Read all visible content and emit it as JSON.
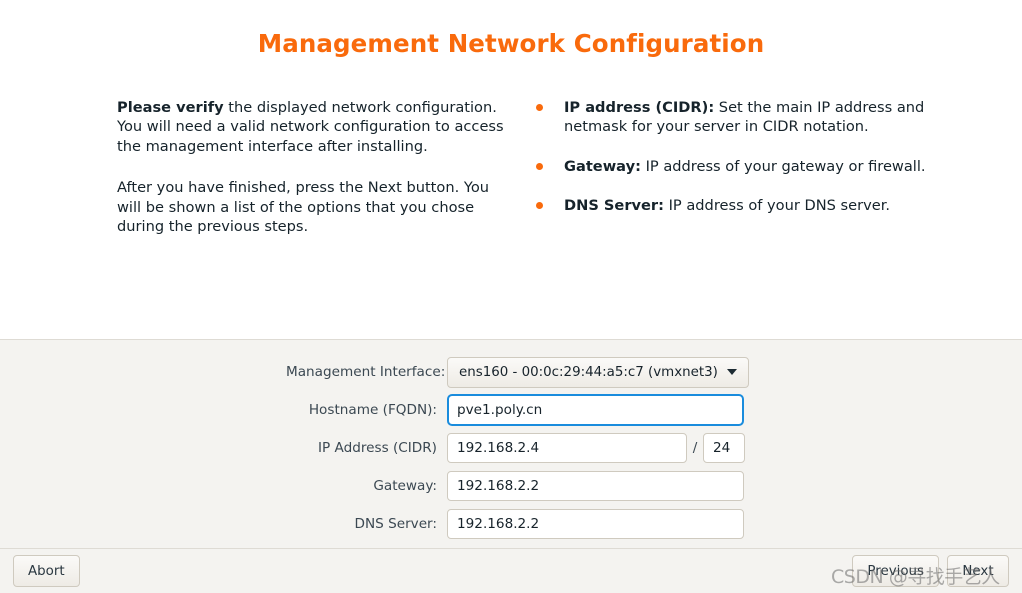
{
  "window": {
    "title": "Management Network Configuration",
    "title_color": "#f96a0c"
  },
  "info": {
    "left_paragraphs": [
      "the displayed network configuration. You will need a valid network configuration to access the management interface after installing.",
      "After you have finished, press the Next button. You will be shown a list of the options that you chose during the previous steps."
    ],
    "left_lead_bold": "Please verify",
    "bullets": [
      {
        "term": "IP address (CIDR):",
        "description": " Set the main IP address and netmask for your server in CIDR notation.",
        "bullet_color": "#f96a0c"
      },
      {
        "term": "Gateway:",
        "description": " IP address of your gateway or firewall.",
        "bullet_color": "#f96a0c"
      },
      {
        "term": "DNS Server:",
        "description": " IP address of your DNS server.",
        "bullet_color": "#f96a0c"
      }
    ]
  },
  "form": {
    "management_interface": {
      "label": "Management Interface:",
      "value": "ens160 - 00:0c:29:44:a5:c7 (vmxnet3)",
      "caret_icon": "chevron-down-icon"
    },
    "hostname": {
      "label": "Hostname (FQDN):",
      "value": "pve1.poly.cn",
      "focused": true,
      "focus_color": "#1a8cdd"
    },
    "ip_address": {
      "label": "IP Address (CIDR)",
      "value": "192.168.2.4",
      "separator": "/",
      "prefix": "24"
    },
    "gateway": {
      "label": "Gateway:",
      "value": "192.168.2.2"
    },
    "dns_server": {
      "label": "DNS Server:",
      "value": "192.168.2.2"
    }
  },
  "buttons": {
    "abort": "Abort",
    "previous": "Previous",
    "next": "Next"
  },
  "watermark": {
    "text": "CSDN @寻找手艺人"
  }
}
